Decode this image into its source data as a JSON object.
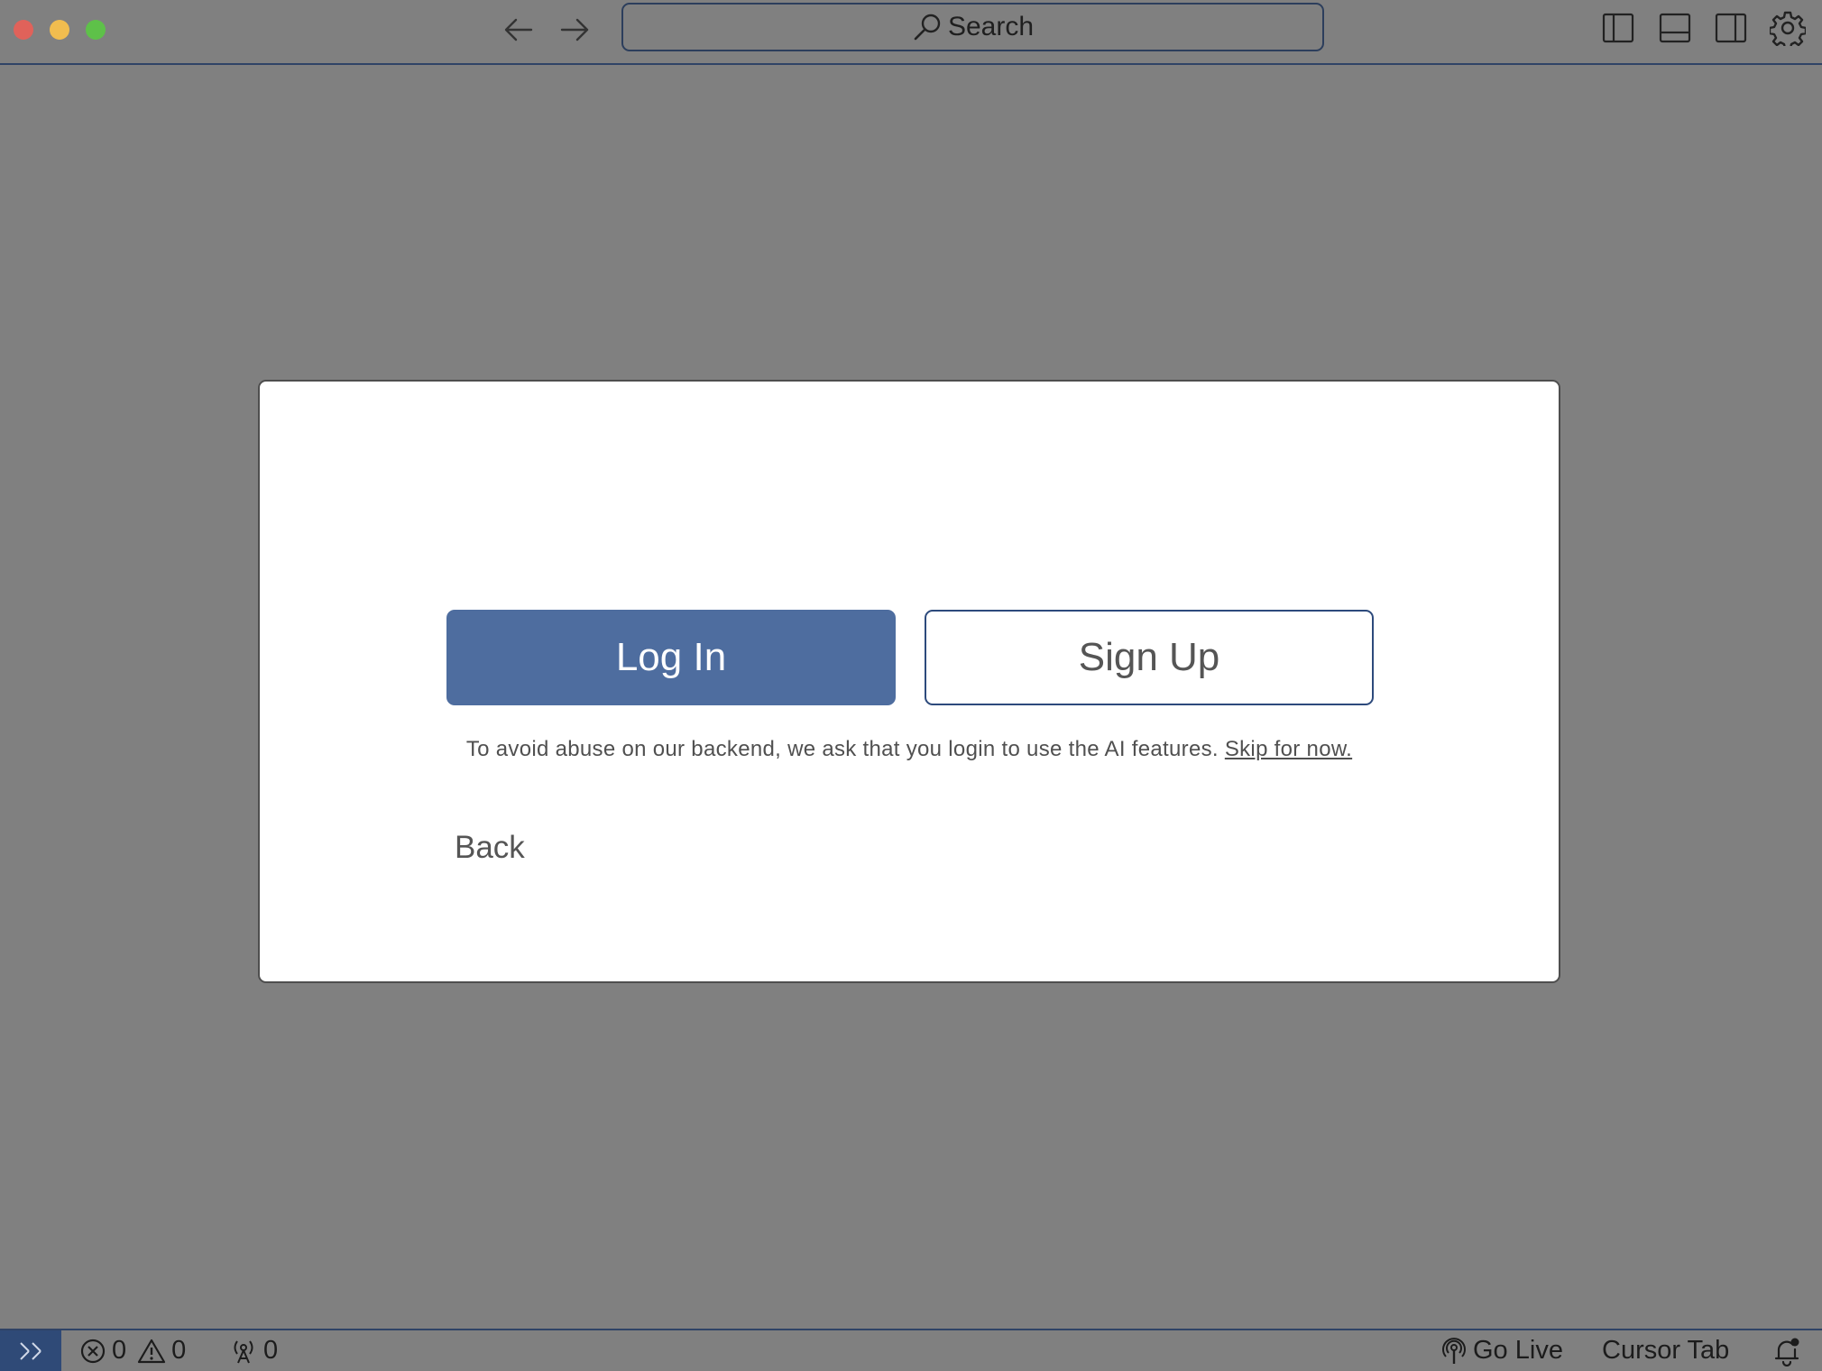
{
  "titlebar": {
    "search_label": "Search",
    "icons": {
      "back": "arrow-left-icon",
      "forward": "arrow-right-icon",
      "search": "search-icon",
      "toggle_primary_sidebar": "sidebar-left-icon",
      "toggle_panel": "panel-bottom-icon",
      "toggle_secondary_sidebar": "sidebar-right-icon",
      "settings": "gear-icon"
    }
  },
  "modal": {
    "login_label": "Log In",
    "signup_label": "Sign Up",
    "notice_text": "To avoid abuse on our backend, we ask that you login to use the AI features. ",
    "skip_label": "Skip for now.",
    "back_label": "Back"
  },
  "statusbar": {
    "errors_count": "0",
    "warnings_count": "0",
    "ports_count": "0",
    "go_live_label": "Go Live",
    "cursor_tab_label": "Cursor Tab"
  },
  "colors": {
    "background": "#808080",
    "accent": "#4e6d9f",
    "remote_indicator": "#2f4a77",
    "close": "#e0625a",
    "minimize": "#f1bd4f",
    "maximize": "#5ec149"
  }
}
